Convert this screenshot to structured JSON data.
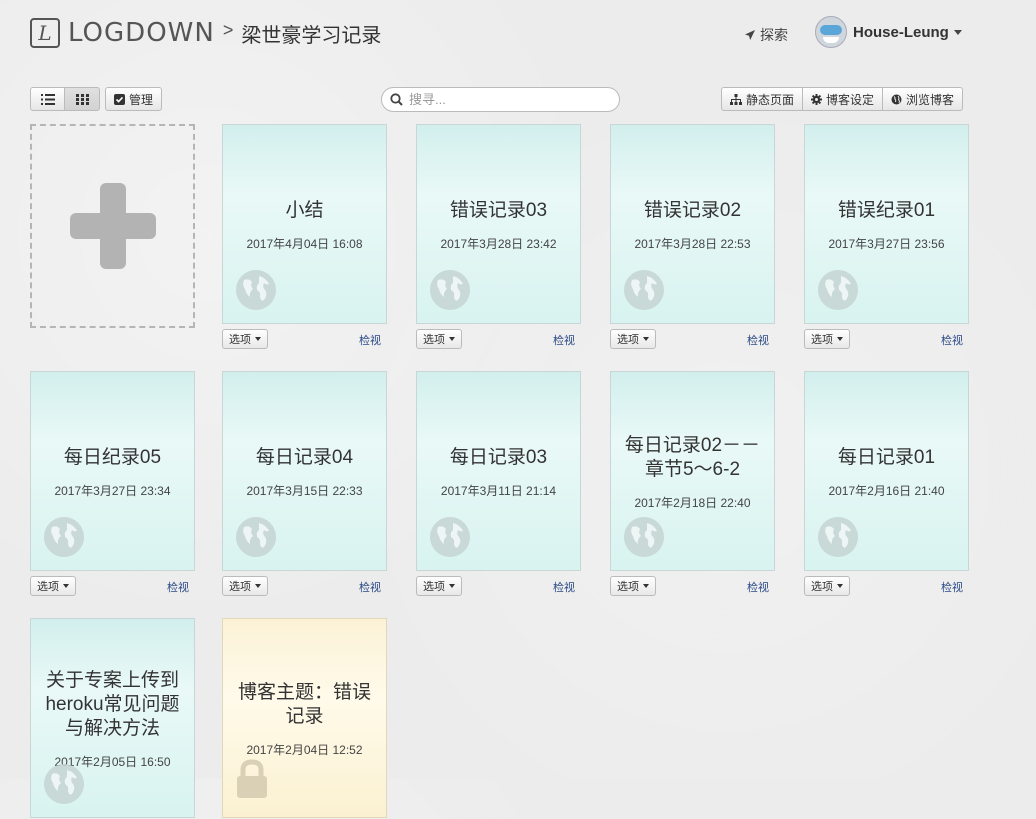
{
  "header": {
    "logo_mark": "L",
    "logo_text": "LOGDOWN",
    "crumb_sep": ">",
    "blog_title": "梁世豪学习记录",
    "explore_label": "探索",
    "username": "House-Leung"
  },
  "toolbar": {
    "manage_label": "管理",
    "search_placeholder": "搜寻...",
    "static_pages_label": "静态页面",
    "blog_settings_label": "博客设定",
    "browse_blog_label": "浏览博客"
  },
  "card_actions": {
    "options_label": "选项",
    "view_label": "检视"
  },
  "posts": [
    {
      "title": "小结",
      "date": "2017年4月04日 16:08",
      "status": "published"
    },
    {
      "title": "错误记录03",
      "date": "2017年3月28日 23:42",
      "status": "published"
    },
    {
      "title": "错误记录02",
      "date": "2017年3月28日 22:53",
      "status": "published"
    },
    {
      "title": "错误纪录01",
      "date": "2017年3月27日 23:56",
      "status": "published"
    },
    {
      "title": "每日纪录05",
      "date": "2017年3月27日 23:34",
      "status": "published"
    },
    {
      "title": "每日记录04",
      "date": "2017年3月15日 22:33",
      "status": "published"
    },
    {
      "title": "每日记录03",
      "date": "2017年3月11日 21:14",
      "status": "published"
    },
    {
      "title": "每日记录02－－章节5～6-2",
      "date": "2017年2月18日 22:40",
      "status": "published"
    },
    {
      "title": "每日记录01",
      "date": "2017年2月16日 21:40",
      "status": "published"
    },
    {
      "title": "关于专案上传到heroku常见问题与解决方法",
      "date": "2017年2月05日 16:50",
      "status": "published"
    },
    {
      "title": "博客主题：错误记录",
      "date": "2017年2月04日 12:52",
      "status": "draft"
    }
  ],
  "colors": {
    "published_card": "#e0f6f3",
    "draft_card": "#fdf5dc",
    "link": "#2b4a86"
  }
}
